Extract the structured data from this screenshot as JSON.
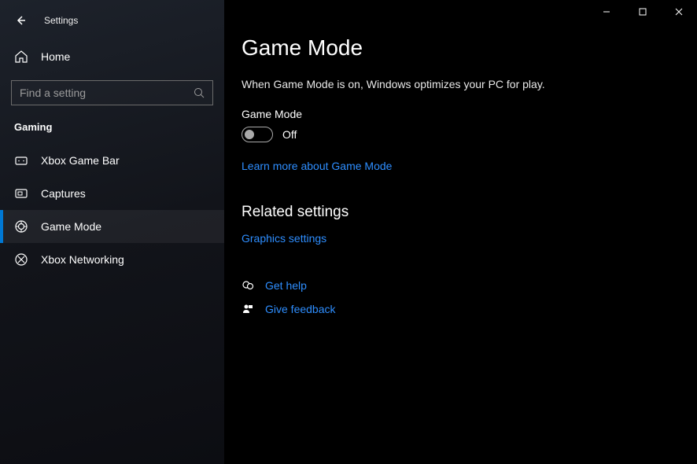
{
  "window": {
    "title": "Settings"
  },
  "sidebar": {
    "home_label": "Home",
    "search_placeholder": "Find a setting",
    "category_label": "Gaming",
    "items": [
      {
        "label": "Xbox Game Bar",
        "icon": "gamebar-icon",
        "active": false
      },
      {
        "label": "Captures",
        "icon": "captures-icon",
        "active": false
      },
      {
        "label": "Game Mode",
        "icon": "gamemode-icon",
        "active": true
      },
      {
        "label": "Xbox Networking",
        "icon": "xbox-icon",
        "active": false
      }
    ]
  },
  "main": {
    "page_title": "Game Mode",
    "description": "When Game Mode is on, Windows optimizes your PC for play.",
    "toggle": {
      "label": "Game Mode",
      "state": "Off",
      "on": false
    },
    "learn_more_label": "Learn more about Game Mode",
    "related_section_title": "Related settings",
    "graphics_settings_label": "Graphics settings",
    "get_help_label": "Get help",
    "give_feedback_label": "Give feedback"
  }
}
